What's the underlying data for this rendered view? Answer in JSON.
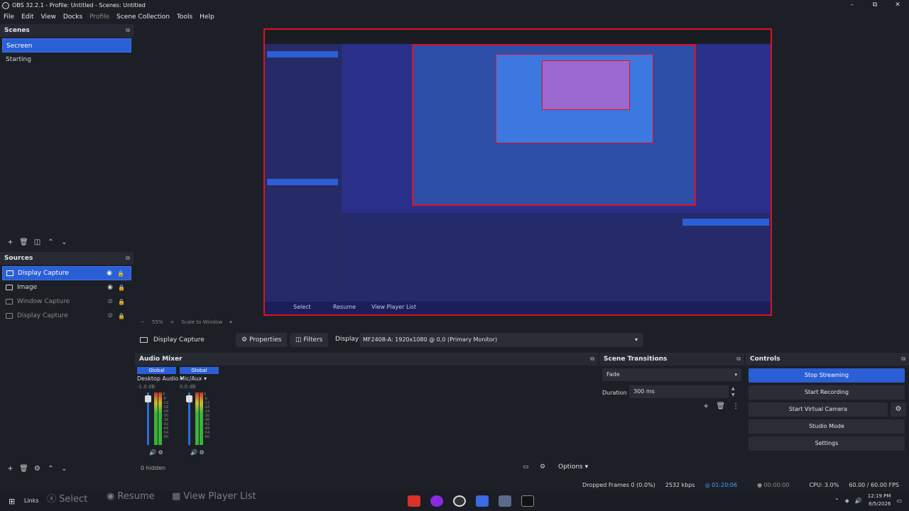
{
  "window": {
    "title": "OBS 32.2.1 - Profile: Untitled - Scenes: Untitled"
  },
  "menu": [
    {
      "label": "File",
      "dim": false
    },
    {
      "label": "Edit",
      "dim": false
    },
    {
      "label": "View",
      "dim": false
    },
    {
      "label": "Docks",
      "dim": false
    },
    {
      "label": "Profile",
      "dim": true
    },
    {
      "label": "Scene Collection",
      "dim": false
    },
    {
      "label": "Tools",
      "dim": false
    },
    {
      "label": "Help",
      "dim": false
    }
  ],
  "scenes": {
    "title": "Scenes",
    "items": [
      "Secreen",
      "Starting"
    ],
    "selected": 0
  },
  "sources": {
    "title": "Sources",
    "items": [
      {
        "label": "Display Capture",
        "icon": "monitor-icon",
        "selected": true,
        "visible": true,
        "dim": false
      },
      {
        "label": "Image",
        "icon": "image-icon",
        "selected": false,
        "visible": true,
        "dim": false
      },
      {
        "label": "Window Capture",
        "icon": "window-icon",
        "selected": false,
        "visible": false,
        "dim": true
      },
      {
        "label": "Display Capture",
        "icon": "monitor-icon",
        "selected": false,
        "visible": false,
        "dim": true
      }
    ]
  },
  "preview": {
    "zoom": "55%",
    "scale": "Scale to Window",
    "nested_taskbar": [
      "Select",
      "Resume",
      "View Player List"
    ]
  },
  "context": {
    "source_name": "Display Capture",
    "properties": "Properties",
    "filters": "Filters",
    "display_label": "Display",
    "display_value": "MF2408-A: 1920x1080 @ 0,0 (Primary Monitor)"
  },
  "audio_mixer": {
    "title": "Audio Mixer",
    "channels": [
      {
        "badge": "Global",
        "name": "Desktop Audio",
        "db": "-1.0 dB"
      },
      {
        "badge": "Global",
        "name": "Mic/Aux",
        "db": "0.0 dB"
      }
    ],
    "scale": [
      "0",
      "-6",
      "-12",
      "-18",
      "-24",
      "-30",
      "-36",
      "-42",
      "-48",
      "-54",
      "-60"
    ],
    "hidden": "0 hidden",
    "options": "Options"
  },
  "scene_transitions": {
    "title": "Scene Transitions",
    "transition": "Fade",
    "duration_label": "Duration",
    "duration_value": "300 ms"
  },
  "controls": {
    "title": "Controls",
    "stop_streaming": "Stop Streaming",
    "start_recording": "Start Recording",
    "start_virtual_camera": "Start Virtual Camera",
    "studio_mode": "Studio Mode",
    "settings": "Settings"
  },
  "status": {
    "dropped_frames": "Dropped Frames 0 (0.0%)",
    "bitrate": "2532 kbps",
    "stream_time": "01:20:06",
    "rec_time": "00:00:00",
    "cpu": "CPU: 3.0%",
    "fps": "60.00 / 60.00 FPS"
  },
  "taskbar": {
    "links": "Links",
    "ghost": [
      "Select",
      "Resume",
      "View Player List"
    ],
    "time": "12:19 PM",
    "date": "8/5/2026"
  },
  "colors": {
    "accent": "#2b5fd6",
    "live": "#4aa3ff",
    "preview_border": "#e01020"
  }
}
